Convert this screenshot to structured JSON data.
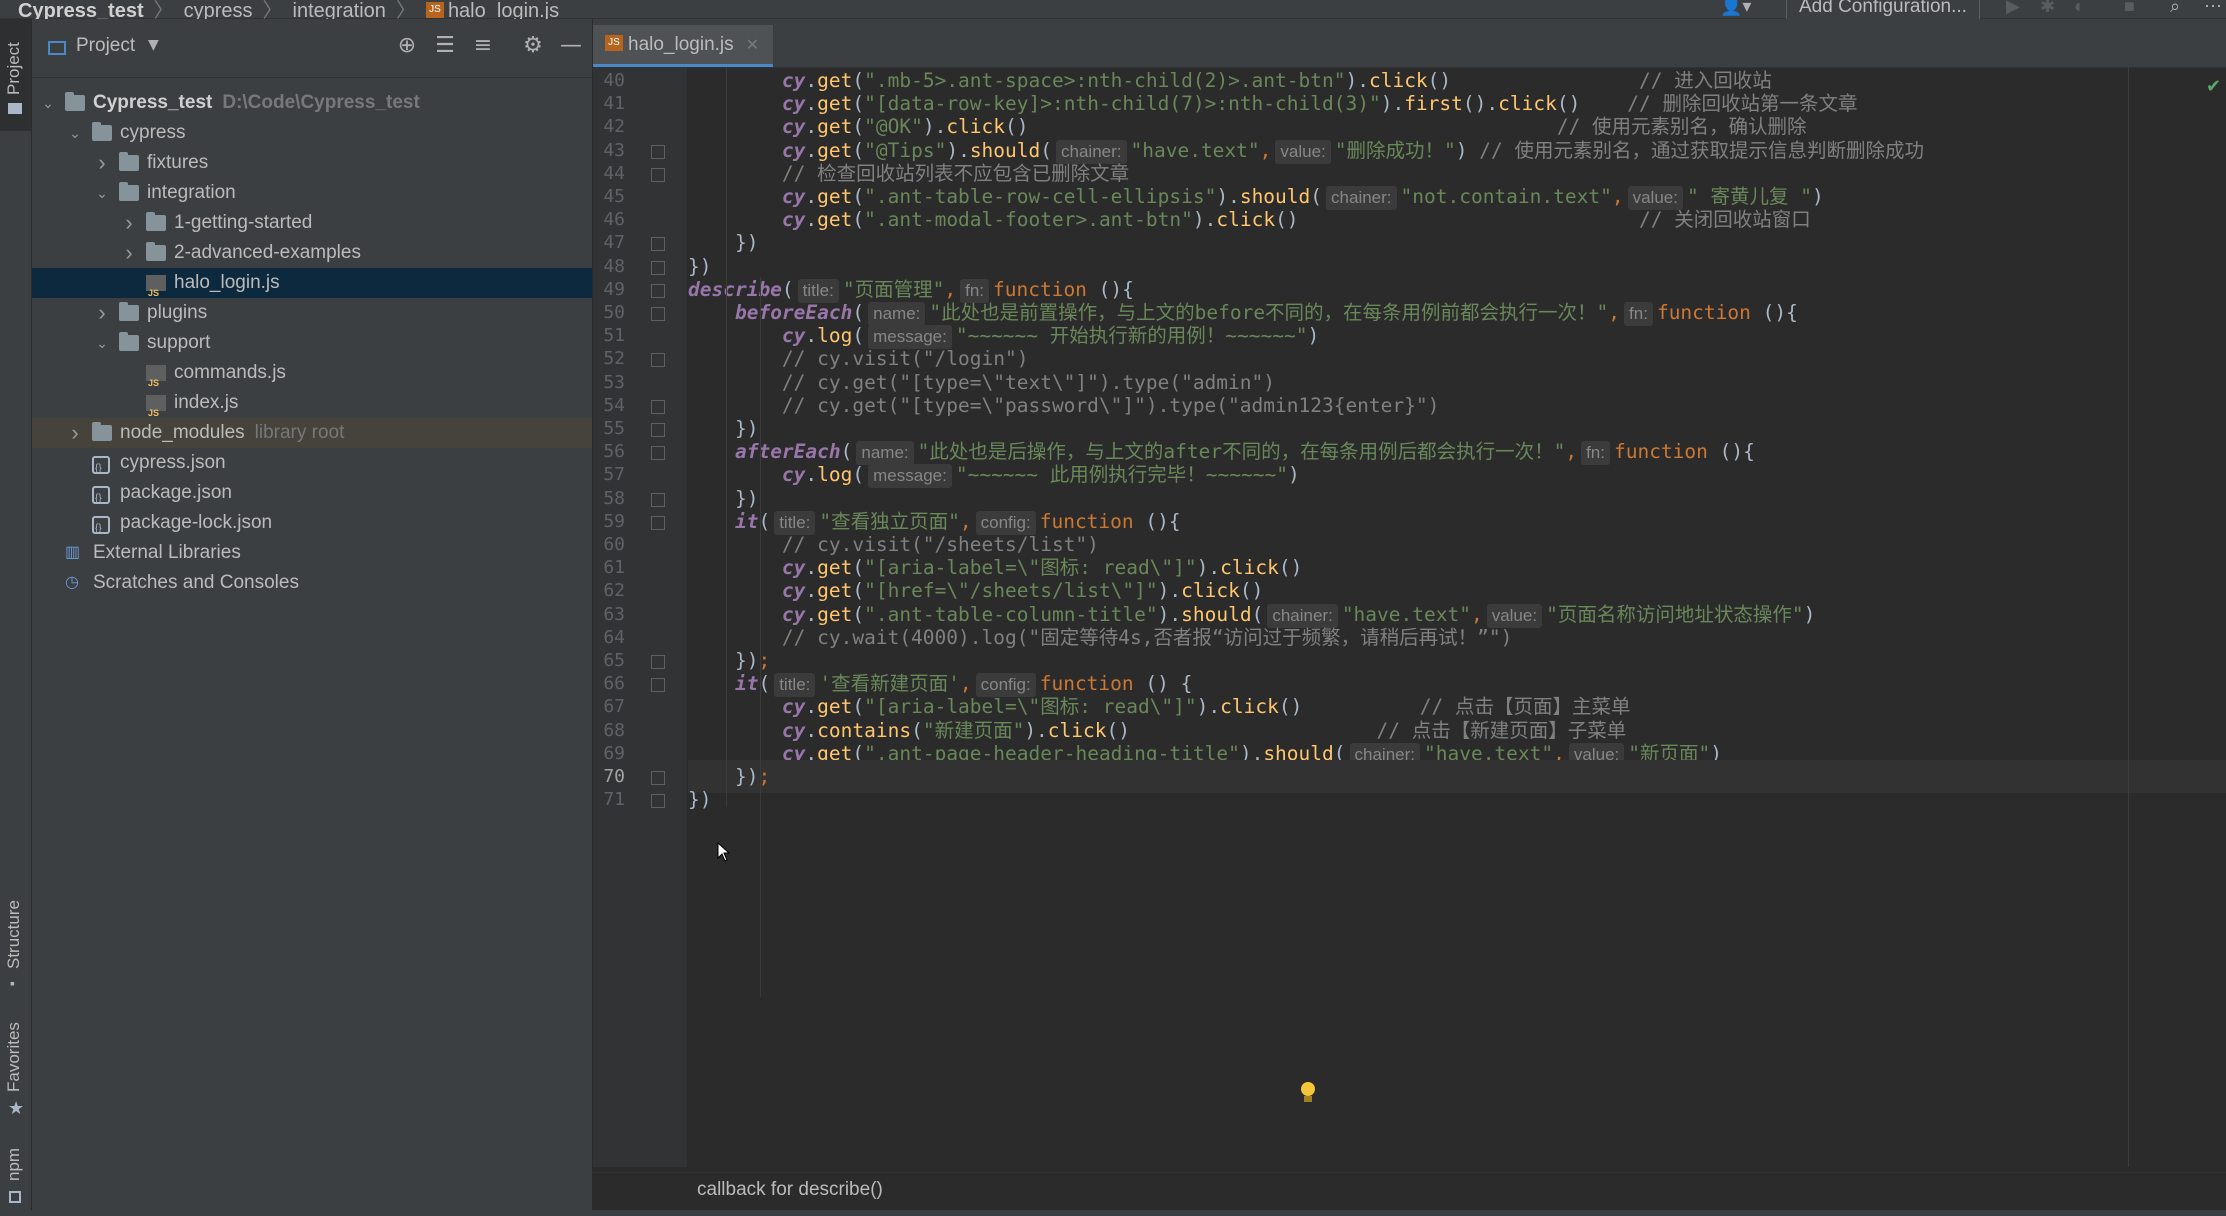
{
  "navbar": {
    "crumbs": [
      "Cypress_test",
      "cypress",
      "integration",
      "halo_login.js"
    ],
    "add_config": "Add Configuration..."
  },
  "left_strip": {
    "project": "Project",
    "structure": "Structure",
    "favorites": "Favorites",
    "npm": "npm"
  },
  "project_panel": {
    "title": "Project",
    "tree": [
      {
        "label": "Cypress_test",
        "sub": "D:\\Code\\Cypress_test",
        "type": "folder",
        "depth": 0,
        "arrow": "down",
        "bold": true
      },
      {
        "label": "cypress",
        "type": "folder",
        "depth": 1,
        "arrow": "down"
      },
      {
        "label": "fixtures",
        "type": "folder",
        "depth": 2,
        "arrow": "right"
      },
      {
        "label": "integration",
        "type": "folder",
        "depth": 2,
        "arrow": "down"
      },
      {
        "label": "1-getting-started",
        "type": "folder",
        "depth": 3,
        "arrow": "right"
      },
      {
        "label": "2-advanced-examples",
        "type": "folder",
        "depth": 3,
        "arrow": "right"
      },
      {
        "label": "halo_login.js",
        "type": "js",
        "depth": 3,
        "arrow": "none",
        "selected": true
      },
      {
        "label": "plugins",
        "type": "folder",
        "depth": 2,
        "arrow": "right"
      },
      {
        "label": "support",
        "type": "folder",
        "depth": 2,
        "arrow": "down"
      },
      {
        "label": "commands.js",
        "type": "js",
        "depth": 3,
        "arrow": "none"
      },
      {
        "label": "index.js",
        "type": "js",
        "depth": 3,
        "arrow": "none"
      },
      {
        "label": "node_modules",
        "sub": "library root",
        "type": "folder",
        "depth": 1,
        "arrow": "right",
        "hilite": true
      },
      {
        "label": "cypress.json",
        "type": "json",
        "depth": 1,
        "arrow": "none"
      },
      {
        "label": "package.json",
        "type": "json",
        "depth": 1,
        "arrow": "none"
      },
      {
        "label": "package-lock.json",
        "type": "json",
        "depth": 1,
        "arrow": "none"
      },
      {
        "label": "External Libraries",
        "type": "lib",
        "depth": 0,
        "arrow": "none"
      },
      {
        "label": "Scratches and Consoles",
        "type": "scratch",
        "depth": 0,
        "arrow": "none"
      }
    ]
  },
  "editor": {
    "tab": "halo_login.js",
    "current_line": 70,
    "lines": [
      {
        "n": 40,
        "t": [
          [
            "pad",
            "        "
          ],
          [
            "cy",
            "cy"
          ],
          [
            "p",
            "."
          ],
          [
            "fn",
            "get"
          ],
          [
            "p",
            "("
          ],
          [
            "s",
            "\".mb-5>.ant-space>:nth-child(2)>.ant-btn\""
          ],
          [
            "p",
            ")."
          ],
          [
            "fn",
            "click"
          ],
          [
            "p",
            "()"
          ],
          [
            "p",
            "                "
          ],
          [
            "c",
            "// 进入回收站"
          ]
        ]
      },
      {
        "n": 41,
        "t": [
          [
            "pad",
            "        "
          ],
          [
            "cy",
            "cy"
          ],
          [
            "p",
            "."
          ],
          [
            "fn",
            "get"
          ],
          [
            "p",
            "("
          ],
          [
            "s",
            "\"[data-row-key]>:nth-child(7)>:nth-child(3)\""
          ],
          [
            "p",
            ")."
          ],
          [
            "fn",
            "first"
          ],
          [
            "p",
            "()."
          ],
          [
            "fn",
            "click"
          ],
          [
            "p",
            "()"
          ],
          [
            "p",
            "    "
          ],
          [
            "c",
            "// 删除回收站第一条文章"
          ]
        ]
      },
      {
        "n": 42,
        "t": [
          [
            "pad",
            "        "
          ],
          [
            "cy",
            "cy"
          ],
          [
            "p",
            "."
          ],
          [
            "fn",
            "get"
          ],
          [
            "p",
            "("
          ],
          [
            "s",
            "\"@OK\""
          ],
          [
            "p",
            ")."
          ],
          [
            "fn",
            "click"
          ],
          [
            "p",
            "()"
          ],
          [
            "p",
            "                                             "
          ],
          [
            "c",
            "// 使用元素别名，确认删除"
          ]
        ]
      },
      {
        "n": 43,
        "t": [
          [
            "pad",
            "        "
          ],
          [
            "cy",
            "cy"
          ],
          [
            "p",
            "."
          ],
          [
            "fn",
            "get"
          ],
          [
            "p",
            "("
          ],
          [
            "s",
            "\"@Tips\""
          ],
          [
            "p",
            ")."
          ],
          [
            "fn",
            "should"
          ],
          [
            "p",
            "("
          ],
          [
            "h",
            "chainer:"
          ],
          [
            "s",
            "\"have.text\""
          ],
          [
            "k",
            ","
          ],
          [
            "h",
            "value:"
          ],
          [
            "s",
            "\"删除成功！\""
          ],
          [
            "p",
            ") "
          ],
          [
            "c",
            "// 使用元素别名，通过获取提示信息判断删除成功"
          ]
        ]
      },
      {
        "n": 44,
        "t": [
          [
            "pad",
            "        "
          ],
          [
            "c",
            "// 检查回收站列表不应包含已删除文章"
          ]
        ]
      },
      {
        "n": 45,
        "t": [
          [
            "pad",
            "        "
          ],
          [
            "cy",
            "cy"
          ],
          [
            "p",
            "."
          ],
          [
            "fn",
            "get"
          ],
          [
            "p",
            "("
          ],
          [
            "s",
            "\".ant-table-row-cell-ellipsis\""
          ],
          [
            "p",
            ")."
          ],
          [
            "fn",
            "should"
          ],
          [
            "p",
            "("
          ],
          [
            "h",
            "chainer:"
          ],
          [
            "s",
            "\"not.contain.text\""
          ],
          [
            "k",
            ","
          ],
          [
            "h",
            "value:"
          ],
          [
            "s",
            "\" 寄黄儿复 \""
          ],
          [
            "p",
            ")"
          ]
        ]
      },
      {
        "n": 46,
        "t": [
          [
            "pad",
            "        "
          ],
          [
            "cy",
            "cy"
          ],
          [
            "p",
            "."
          ],
          [
            "fn",
            "get"
          ],
          [
            "p",
            "("
          ],
          [
            "s",
            "\".ant-modal-footer>.ant-btn\""
          ],
          [
            "p",
            ")."
          ],
          [
            "fn",
            "click"
          ],
          [
            "p",
            "()"
          ],
          [
            "p",
            "                             "
          ],
          [
            "c",
            "// 关闭回收站窗口"
          ]
        ]
      },
      {
        "n": 47,
        "t": [
          [
            "pad",
            "    "
          ],
          [
            "p",
            "})"
          ]
        ]
      },
      {
        "n": 48,
        "t": [
          [
            "p",
            "})"
          ]
        ]
      },
      {
        "n": 49,
        "t": [
          [
            "d",
            "describe"
          ],
          [
            "p",
            "("
          ],
          [
            "h",
            "title:"
          ],
          [
            "s",
            "\"页面管理\""
          ],
          [
            "k",
            ","
          ],
          [
            "h",
            "fn:"
          ],
          [
            "k",
            "function "
          ],
          [
            "p",
            "(){"
          ]
        ]
      },
      {
        "n": 50,
        "t": [
          [
            "pad",
            "    "
          ],
          [
            "d",
            "beforeEach"
          ],
          [
            "p",
            "("
          ],
          [
            "h",
            "name:"
          ],
          [
            "s",
            "\"此处也是前置操作，与上文的before不同的，在每条用例前都会执行一次！\""
          ],
          [
            "k",
            ","
          ],
          [
            "h",
            "fn:"
          ],
          [
            "k",
            "function "
          ],
          [
            "p",
            "(){"
          ]
        ]
      },
      {
        "n": 51,
        "t": [
          [
            "pad",
            "        "
          ],
          [
            "cy",
            "cy"
          ],
          [
            "p",
            "."
          ],
          [
            "fn",
            "log"
          ],
          [
            "p",
            "("
          ],
          [
            "h",
            "message:"
          ],
          [
            "s",
            "\"~~~~~~ 开始执行新的用例！~~~~~~\""
          ],
          [
            "p",
            ")"
          ]
        ]
      },
      {
        "n": 52,
        "t": [
          [
            "pad",
            "        "
          ],
          [
            "c",
            "// cy.visit(\"/login\")"
          ]
        ]
      },
      {
        "n": 53,
        "t": [
          [
            "pad",
            "        "
          ],
          [
            "c",
            "// cy.get(\"[type=\\\"text\\\"]\").type(\"admin\")"
          ]
        ]
      },
      {
        "n": 54,
        "t": [
          [
            "pad",
            "        "
          ],
          [
            "c",
            "// cy.get(\"[type=\\\"password\\\"]\").type(\"admin123{enter}\")"
          ]
        ]
      },
      {
        "n": 55,
        "t": [
          [
            "pad",
            "    "
          ],
          [
            "p",
            "})"
          ]
        ]
      },
      {
        "n": 56,
        "t": [
          [
            "pad",
            "    "
          ],
          [
            "d",
            "afterEach"
          ],
          [
            "p",
            "("
          ],
          [
            "h",
            "name:"
          ],
          [
            "s",
            "\"此处也是后操作，与上文的after不同的，在每条用例后都会执行一次！\""
          ],
          [
            "k",
            ","
          ],
          [
            "h",
            "fn:"
          ],
          [
            "k",
            "function "
          ],
          [
            "p",
            "(){"
          ]
        ]
      },
      {
        "n": 57,
        "t": [
          [
            "pad",
            "        "
          ],
          [
            "cy",
            "cy"
          ],
          [
            "p",
            "."
          ],
          [
            "fn",
            "log"
          ],
          [
            "p",
            "("
          ],
          [
            "h",
            "message:"
          ],
          [
            "s",
            "\"~~~~~~ 此用例执行完毕！~~~~~~\""
          ],
          [
            "p",
            ")"
          ]
        ]
      },
      {
        "n": 58,
        "t": [
          [
            "pad",
            "    "
          ],
          [
            "p",
            "})"
          ]
        ]
      },
      {
        "n": 59,
        "t": [
          [
            "pad",
            "    "
          ],
          [
            "d",
            "it"
          ],
          [
            "p",
            "("
          ],
          [
            "h",
            "title:"
          ],
          [
            "s",
            "\"查看独立页面\""
          ],
          [
            "k",
            ","
          ],
          [
            "h",
            "config:"
          ],
          [
            "k",
            "function "
          ],
          [
            "p",
            "(){"
          ]
        ]
      },
      {
        "n": 60,
        "t": [
          [
            "pad",
            "        "
          ],
          [
            "c",
            "// cy.visit(\"/sheets/list\")"
          ]
        ]
      },
      {
        "n": 61,
        "t": [
          [
            "pad",
            "        "
          ],
          [
            "cy",
            "cy"
          ],
          [
            "p",
            "."
          ],
          [
            "fn",
            "get"
          ],
          [
            "p",
            "("
          ],
          [
            "s",
            "\"[aria-label=\\\"图标: read\\\"]\""
          ],
          [
            "p",
            ")."
          ],
          [
            "fn",
            "click"
          ],
          [
            "p",
            "()"
          ]
        ]
      },
      {
        "n": 62,
        "t": [
          [
            "pad",
            "        "
          ],
          [
            "cy",
            "cy"
          ],
          [
            "p",
            "."
          ],
          [
            "fn",
            "get"
          ],
          [
            "p",
            "("
          ],
          [
            "s",
            "\"[href=\\\"/sheets/list\\\"]\""
          ],
          [
            "p",
            ")."
          ],
          [
            "fn",
            "click"
          ],
          [
            "p",
            "()"
          ]
        ]
      },
      {
        "n": 63,
        "t": [
          [
            "pad",
            "        "
          ],
          [
            "cy",
            "cy"
          ],
          [
            "p",
            "."
          ],
          [
            "fn",
            "get"
          ],
          [
            "p",
            "("
          ],
          [
            "s",
            "\".ant-table-column-title\""
          ],
          [
            "p",
            ")."
          ],
          [
            "fn",
            "should"
          ],
          [
            "p",
            "("
          ],
          [
            "h",
            "chainer:"
          ],
          [
            "s",
            "\"have.text\""
          ],
          [
            "k",
            ","
          ],
          [
            "h",
            "value:"
          ],
          [
            "s",
            "\"页面名称访问地址状态操作\""
          ],
          [
            "p",
            ")"
          ]
        ]
      },
      {
        "n": 64,
        "t": [
          [
            "pad",
            "        "
          ],
          [
            "c",
            "// cy.wait(4000).log(\"固定等待4s,否者报“访问过于频繁，请稍后再试！”\")"
          ]
        ]
      },
      {
        "n": 65,
        "t": [
          [
            "pad",
            "    "
          ],
          [
            "p",
            "})"
          ],
          [
            "k",
            ";"
          ]
        ]
      },
      {
        "n": 66,
        "t": [
          [
            "pad",
            "    "
          ],
          [
            "d",
            "it"
          ],
          [
            "p",
            "("
          ],
          [
            "h",
            "title:"
          ],
          [
            "s",
            "'查看新建页面'"
          ],
          [
            "k",
            ","
          ],
          [
            "h",
            "config:"
          ],
          [
            "k",
            "function "
          ],
          [
            "p",
            "() {"
          ]
        ]
      },
      {
        "n": 67,
        "t": [
          [
            "pad",
            "        "
          ],
          [
            "cy",
            "cy"
          ],
          [
            "p",
            "."
          ],
          [
            "fn",
            "get"
          ],
          [
            "p",
            "("
          ],
          [
            "s",
            "\"[aria-label=\\\"图标: read\\\"]\""
          ],
          [
            "p",
            ")."
          ],
          [
            "fn",
            "click"
          ],
          [
            "p",
            "()"
          ],
          [
            "p",
            "          "
          ],
          [
            "c",
            "// 点击【页面】主菜单"
          ]
        ]
      },
      {
        "n": 68,
        "t": [
          [
            "pad",
            "        "
          ],
          [
            "cy",
            "cy"
          ],
          [
            "p",
            "."
          ],
          [
            "fn",
            "contains"
          ],
          [
            "p",
            "("
          ],
          [
            "s",
            "\"新建页面\""
          ],
          [
            "p",
            ")."
          ],
          [
            "fn",
            "click"
          ],
          [
            "p",
            "()"
          ],
          [
            "p",
            "                     "
          ],
          [
            "c",
            "// 点击【新建页面】子菜单"
          ]
        ]
      },
      {
        "n": 69,
        "t": [
          [
            "pad",
            "        "
          ],
          [
            "cy",
            "cy"
          ],
          [
            "p",
            "."
          ],
          [
            "fn",
            "get"
          ],
          [
            "p",
            "("
          ],
          [
            "s",
            "\".ant-page-header-heading-title\""
          ],
          [
            "p",
            ")."
          ],
          [
            "fn",
            "should"
          ],
          [
            "p",
            "("
          ],
          [
            "h",
            "chainer:"
          ],
          [
            "s",
            "\"have.text\""
          ],
          [
            "k",
            ","
          ],
          [
            "h",
            "value:"
          ],
          [
            "s",
            "\"新页面\""
          ],
          [
            "p",
            ")"
          ]
        ]
      },
      {
        "n": 70,
        "t": [
          [
            "pad",
            "    "
          ],
          [
            "p",
            "})"
          ],
          [
            "k",
            ";"
          ]
        ]
      },
      {
        "n": 71,
        "t": [
          [
            "p",
            "})"
          ]
        ]
      }
    ]
  },
  "breadcrumb": "callback for describe()",
  "colors": {
    "accent": "#4a88c7",
    "selection": "#0d293e",
    "string": "#6a8759",
    "keyword": "#cc7832",
    "comment": "#808080",
    "function": "#ffc66d",
    "identifier": "#9876aa"
  }
}
